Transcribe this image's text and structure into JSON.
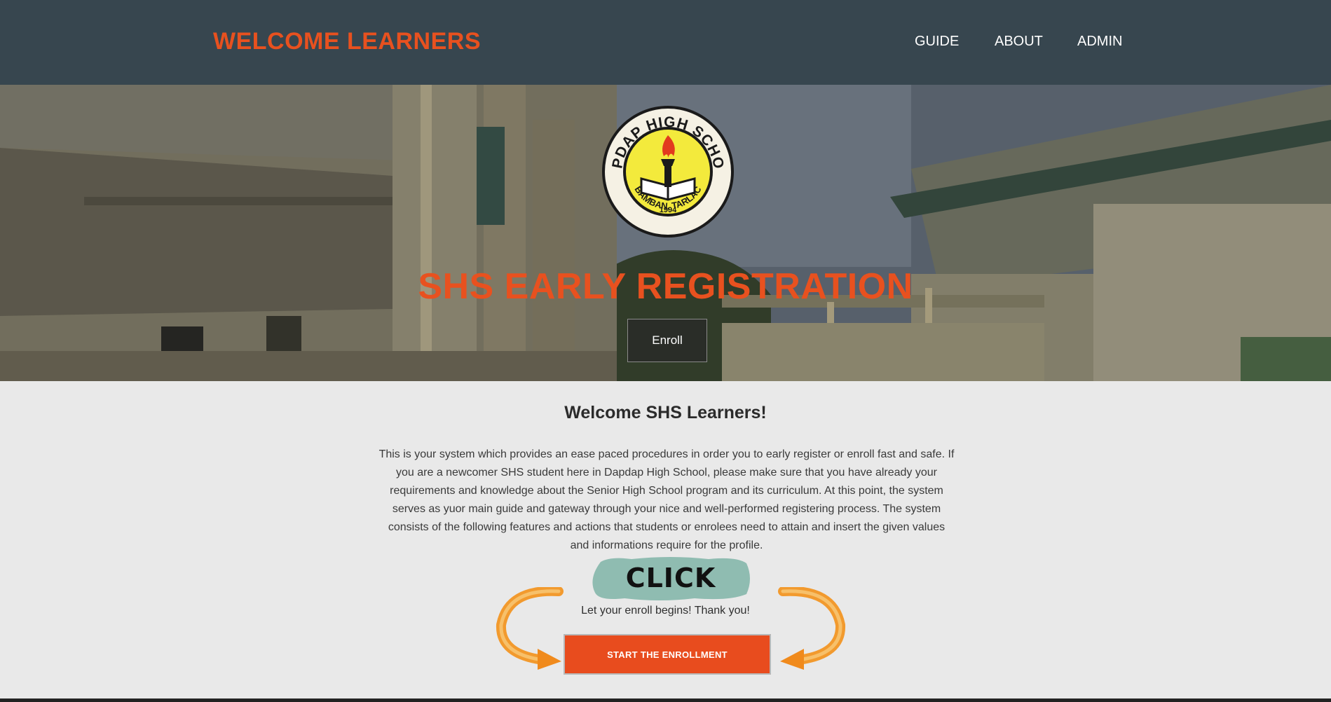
{
  "header": {
    "brand": "WELCOME LEARNERS",
    "nav": [
      "GUIDE",
      "ABOUT",
      "ADMIN"
    ]
  },
  "hero": {
    "title": "SHS EARLY REGISTRATION",
    "enroll_label": "Enroll",
    "logo": {
      "top_text": "DAPDAP HIGH SCHOOL",
      "bottom_text": "BAMBAN, TARLAC",
      "year": "1994"
    }
  },
  "content": {
    "title": "Welcome SHS Learners!",
    "intro": "This is your system which provides an ease paced procedures in order you to early register or enroll fast and safe. If you are a newcomer SHS student here in Dapdap High School, please make sure that you have already your requirements and knowledge about the Senior High School program and its curriculum. At this point, the system serves as yuor main guide and gateway through your nice and well-performed registering process. The system consists of the following features and actions that students or enrolees need to attain and insert the given values and informations require for the profile.",
    "click_badge": "CLICK",
    "thanks": "Let your enroll begins! Thank you!",
    "start_label": "START THE ENROLLMENT"
  },
  "colors": {
    "accent": "#e8511f",
    "header_bg": "#37464f",
    "page_bg": "#e9e9e9"
  }
}
